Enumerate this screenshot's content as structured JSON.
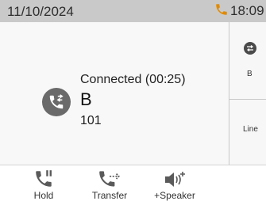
{
  "status_bar": {
    "date": "11/10/2024",
    "time": "18:09",
    "phone_icon": "phone-icon",
    "accent_color": "#e08a00"
  },
  "call": {
    "status": "Connected (00:25)",
    "name": "B",
    "number": "101",
    "icon": "transfer-call-icon"
  },
  "side_panel": {
    "line_label_b": "B",
    "line_label": "Line",
    "icon": "line-key-icon"
  },
  "softkeys": [
    {
      "label": "Hold",
      "icon": "hold-icon"
    },
    {
      "label": "Transfer",
      "icon": "transfer-icon"
    },
    {
      "label": "+Speaker",
      "icon": "speaker-icon"
    }
  ]
}
